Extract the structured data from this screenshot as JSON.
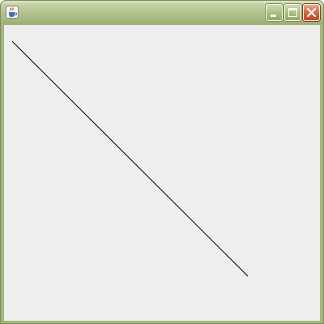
{
  "window": {
    "title": "",
    "icon": "java-coffee-cup-icon",
    "controls": [
      "minimize-icon",
      "maximize-icon",
      "close-icon"
    ]
  },
  "colors": {
    "frame": "#a4b67c",
    "client_background": "#eeeeee",
    "line": "#000000",
    "close_button": "#e0623c"
  },
  "canvas": {
    "shape": "line"
  }
}
